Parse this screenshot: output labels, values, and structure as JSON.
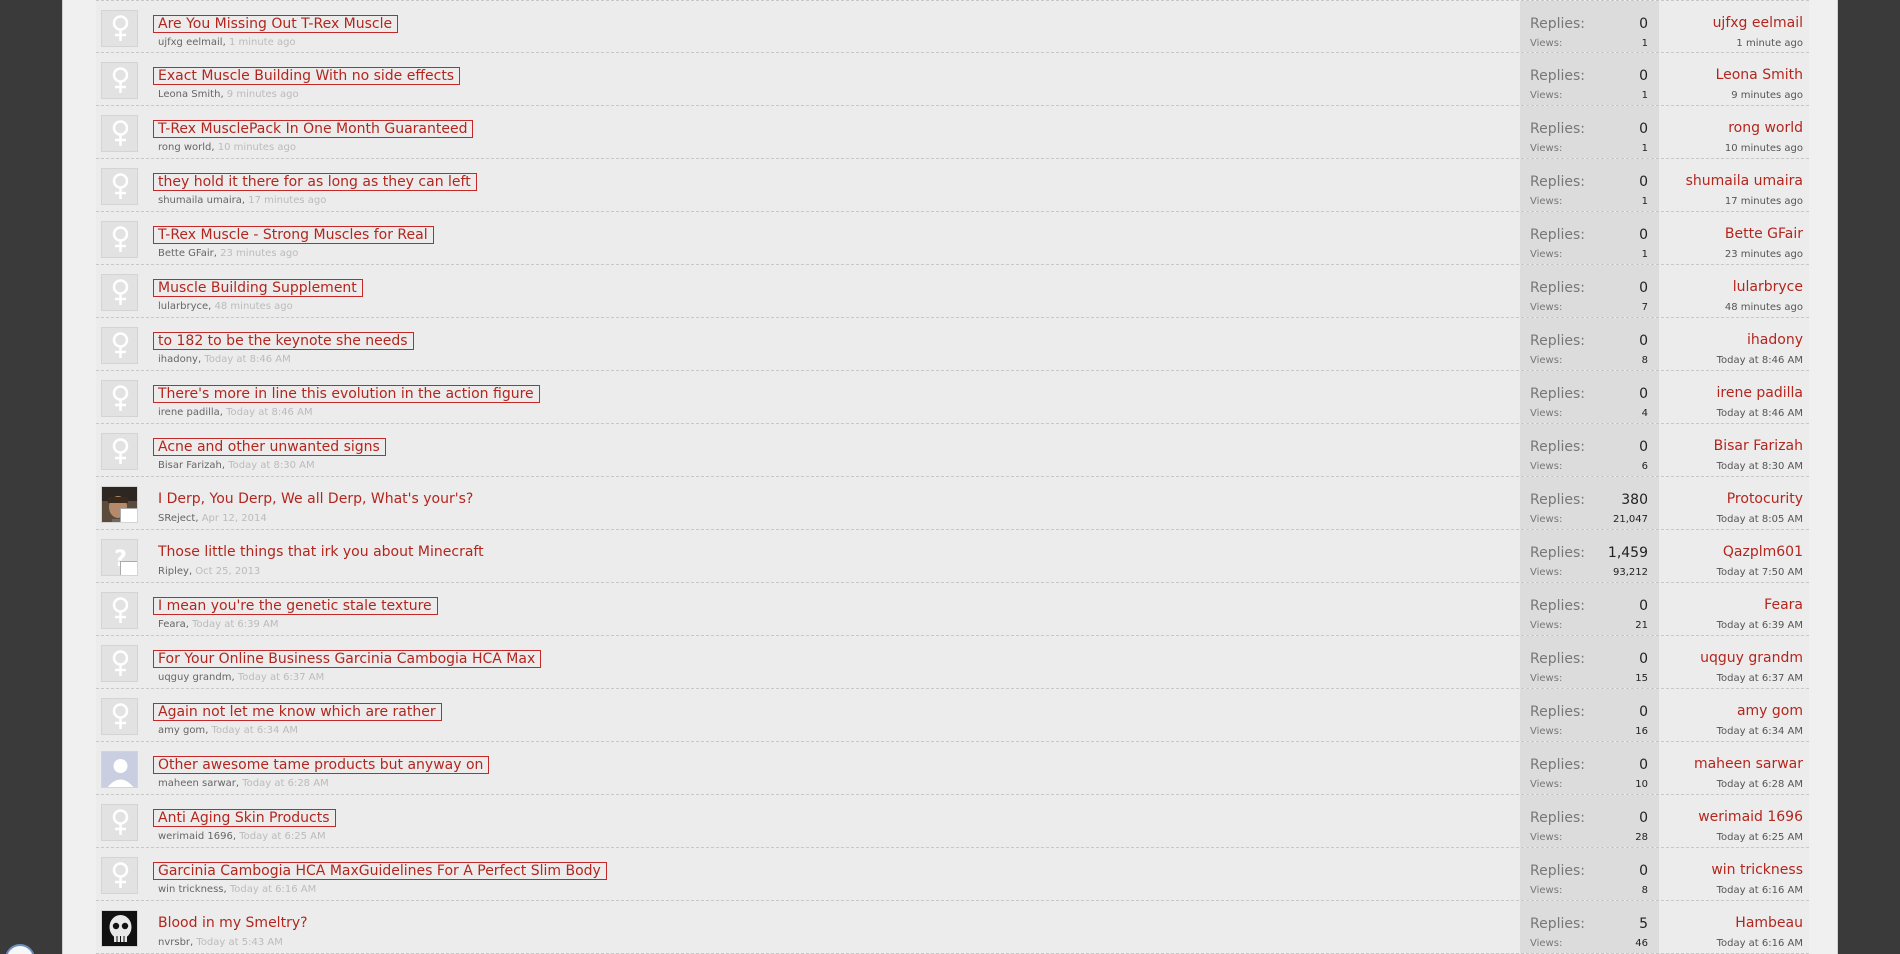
{
  "labels": {
    "replies": "Replies:",
    "views": "Views:"
  },
  "threads": [
    {
      "title": "Are You Missing Out T-Rex Muscle",
      "boxed": true,
      "author": "ujfxg eelmail",
      "time": "1 minute ago",
      "replies": "0",
      "views": "1",
      "last_user": "ujfxg eelmail",
      "last_time": "1 minute ago",
      "avatar": "default-avatar-icon"
    },
    {
      "title": "Exact Muscle Building With no side effects",
      "boxed": true,
      "author": "Leona Smith",
      "time": "9 minutes ago",
      "replies": "0",
      "views": "1",
      "last_user": "Leona Smith",
      "last_time": "9 minutes ago",
      "avatar": "default-avatar-icon"
    },
    {
      "title": "T-Rex MusclePack In One Month Guaranteed",
      "boxed": true,
      "author": "rong world",
      "time": "10 minutes ago",
      "replies": "0",
      "views": "1",
      "last_user": "rong world",
      "last_time": "10 minutes ago",
      "avatar": "default-avatar-icon"
    },
    {
      "title": "they hold it there for as long as they can left",
      "boxed": true,
      "author": "shumaila umaira",
      "time": "17 minutes ago",
      "replies": "0",
      "views": "1",
      "last_user": "shumaila umaira",
      "last_time": "17 minutes ago",
      "avatar": "default-avatar-icon"
    },
    {
      "title": "T-Rex Muscle - Strong Muscles for Real",
      "boxed": true,
      "author": "Bette GFair",
      "time": "23 minutes ago",
      "replies": "0",
      "views": "1",
      "last_user": "Bette GFair",
      "last_time": "23 minutes ago",
      "avatar": "default-avatar-icon"
    },
    {
      "title": "Muscle Building Supplement",
      "boxed": true,
      "author": "lularbryce",
      "time": "48 minutes ago",
      "replies": "0",
      "views": "7",
      "last_user": "lularbryce",
      "last_time": "48 minutes ago",
      "avatar": "default-avatar-icon"
    },
    {
      "title": "to 182 to be the keynote she needs",
      "boxed": true,
      "author": "ihadony",
      "time": "Today at 8:46 AM",
      "replies": "0",
      "views": "8",
      "last_user": "ihadony",
      "last_time": "Today at 8:46 AM",
      "avatar": "default-avatar-icon"
    },
    {
      "title": "There's more in line this evolution in the action figure",
      "boxed": true,
      "author": "irene padilla",
      "time": "Today at 8:46 AM",
      "replies": "0",
      "views": "4",
      "last_user": "irene padilla",
      "last_time": "Today at 8:46 AM",
      "avatar": "default-avatar-icon"
    },
    {
      "title": "Acne and other unwanted signs",
      "boxed": true,
      "author": "Bisar Farizah",
      "time": "Today at 8:30 AM",
      "replies": "0",
      "views": "6",
      "last_user": "Bisar Farizah",
      "last_time": "Today at 8:30 AM",
      "avatar": "default-avatar-icon"
    },
    {
      "title": "I Derp, You Derp, We all Derp, What's your's?",
      "boxed": false,
      "author": "SReject",
      "time": "Apr 12, 2014",
      "replies": "380",
      "views": "21,047",
      "last_user": "Protocurity",
      "last_time": "Today at 8:05 AM",
      "avatar": "photo-avatar-icon"
    },
    {
      "title": "Those little things that irk you about Minecraft",
      "boxed": false,
      "author": "Ripley",
      "time": "Oct 25, 2013",
      "replies": "1,459",
      "views": "93,212",
      "last_user": "Qazplm601",
      "last_time": "Today at 7:50 AM",
      "avatar": "question-avatar-icon"
    },
    {
      "title": "I mean you're the genetic stale texture",
      "boxed": true,
      "author": "Feara",
      "time": "Today at 6:39 AM",
      "replies": "0",
      "views": "21",
      "last_user": "Feara",
      "last_time": "Today at 6:39 AM",
      "avatar": "default-avatar-icon"
    },
    {
      "title": "For Your Online Business Garcinia Cambogia HCA Max",
      "boxed": true,
      "author": "uqguy grandm",
      "time": "Today at 6:37 AM",
      "replies": "0",
      "views": "15",
      "last_user": "uqguy grandm",
      "last_time": "Today at 6:37 AM",
      "avatar": "default-avatar-icon"
    },
    {
      "title": "Again not let me know which are rather",
      "boxed": true,
      "author": "amy gom",
      "time": "Today at 6:34 AM",
      "replies": "0",
      "views": "16",
      "last_user": "amy gom",
      "last_time": "Today at 6:34 AM",
      "avatar": "default-avatar-icon"
    },
    {
      "title": "Other awesome tame products but anyway on",
      "boxed": true,
      "author": "maheen sarwar",
      "time": "Today at 6:28 AM",
      "replies": "0",
      "views": "10",
      "last_user": "maheen sarwar",
      "last_time": "Today at 6:28 AM",
      "avatar": "silhouette-avatar-icon"
    },
    {
      "title": "Anti Aging Skin Products",
      "boxed": true,
      "author": "werimaid 1696",
      "time": "Today at 6:25 AM",
      "replies": "0",
      "views": "28",
      "last_user": "werimaid 1696",
      "last_time": "Today at 6:25 AM",
      "avatar": "default-avatar-icon"
    },
    {
      "title": "Garcinia Cambogia HCA MaxGuidelines For A Perfect Slim Body",
      "boxed": true,
      "author": "win trickness",
      "time": "Today at 6:16 AM",
      "replies": "0",
      "views": "8",
      "last_user": "win trickness",
      "last_time": "Today at 6:16 AM",
      "avatar": "default-avatar-icon"
    },
    {
      "title": "Blood in my Smeltry?",
      "boxed": false,
      "author": "nvrsbr",
      "time": "Today at 5:43 AM",
      "replies": "5",
      "views": "46",
      "last_user": "Hambeau",
      "last_time": "Today at 6:16 AM",
      "avatar": "skull-avatar-icon"
    }
  ]
}
